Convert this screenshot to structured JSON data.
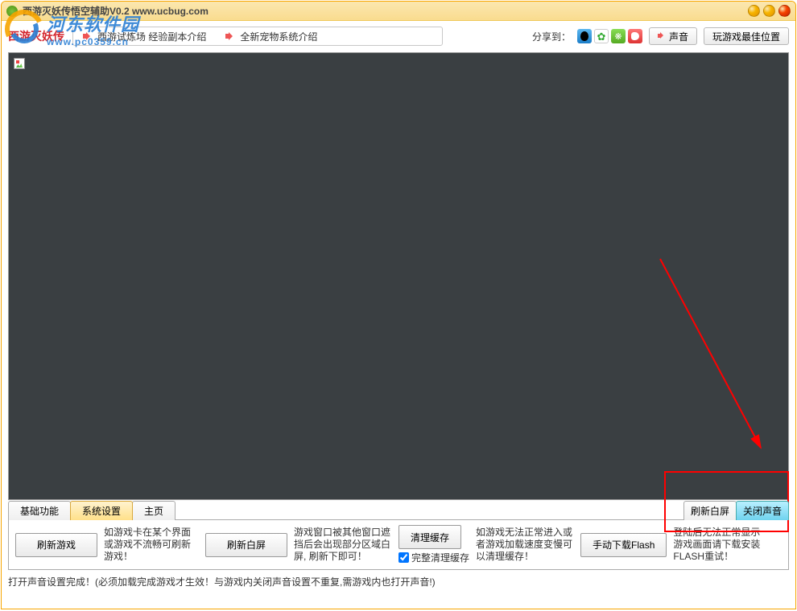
{
  "titlebar": {
    "text": "西游灭妖传悟空辅助V0.2   www.ucbug.com"
  },
  "watermark": {
    "cn": "河东软件园",
    "url": "www.pc0359.cn"
  },
  "toolbar": {
    "game_name": "西游灭妖传",
    "announce1": "西游试炼场 经验副本介绍",
    "announce2": "全新宠物系统介绍",
    "share_label": "分享到：",
    "sound_btn": "声音",
    "pos_btn": "玩游戏最佳位置"
  },
  "tabs": {
    "t1": "基础功能",
    "t2": "系统设置",
    "t3": "主页",
    "refresh_white": "刷新白屏",
    "close_sound": "关闭声音"
  },
  "panel": {
    "btn_refresh_game": "刷新游戏",
    "hint_refresh_game": "如游戏卡在某个界面或游戏不流畅可刷新游戏！",
    "btn_refresh_white": "刷新白屏",
    "hint_refresh_white": "游戏窗口被其他窗口遮挡后会出现部分区域白屏, 刷新下即可！",
    "btn_clear_cache": "清理缓存",
    "chk_full_clear": "完整清理缓存",
    "hint_clear_cache": "如游戏无法正常进入或者游戏加载速度变慢可以清理缓存！",
    "btn_download_flash": "手动下载Flash",
    "hint_download_flash": "登陆后无法正常显示游戏画面请下载安装FLASH重试！"
  },
  "status": "打开声音设置完成！(必须加载完成游戏才生效！与游戏内关闭声音设置不重复,需游戏内也打开声音!)"
}
